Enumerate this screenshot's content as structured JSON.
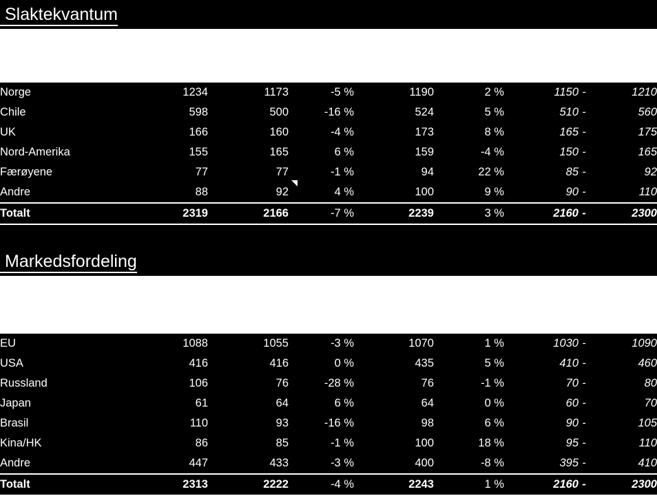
{
  "sections": [
    {
      "title": "Slaktekvantum",
      "rows": [
        {
          "label": "Norge",
          "v1": "1234",
          "v2": "1173",
          "p1": "-5 %",
          "v3": "1190",
          "p2": "2 %",
          "rlo": "1150",
          "dash": "-",
          "rhi": "1210"
        },
        {
          "label": "Chile",
          "v1": "598",
          "v2": "500",
          "p1": "-16 %",
          "v3": "524",
          "p2": "5 %",
          "rlo": "510",
          "dash": "-",
          "rhi": "560"
        },
        {
          "label": "UK",
          "v1": "166",
          "v2": "160",
          "p1": "-4 %",
          "v3": "173",
          "p2": "8 %",
          "rlo": "165",
          "dash": "-",
          "rhi": "175"
        },
        {
          "label": "Nord-Amerika",
          "v1": "155",
          "v2": "165",
          "p1": "6 %",
          "v3": "159",
          "p2": "-4 %",
          "rlo": "150",
          "dash": "-",
          "rhi": "165"
        },
        {
          "label": "Færøyene",
          "v1": "77",
          "v2": "77",
          "p1": "-1 %",
          "v3": "94",
          "p2": "22 %",
          "rlo": "85",
          "dash": "-",
          "rhi": "92"
        },
        {
          "label": "Andre",
          "v1": "88",
          "v2": "92",
          "p1": "4 %",
          "v3": "100",
          "p2": "9 %",
          "rlo": "90",
          "dash": "-",
          "rhi": "110"
        }
      ],
      "total": {
        "label": "Totalt",
        "v1": "2319",
        "v2": "2166",
        "p1": "-7 %",
        "v3": "2239",
        "p2": "3 %",
        "rlo": "2160",
        "dash": "-",
        "rhi": "2300"
      }
    },
    {
      "title": "Markedsfordeling",
      "rows": [
        {
          "label": "EU",
          "v1": "1088",
          "v2": "1055",
          "p1": "-3 %",
          "v3": "1070",
          "p2": "1 %",
          "rlo": "1030",
          "dash": "-",
          "rhi": "1090"
        },
        {
          "label": "USA",
          "v1": "416",
          "v2": "416",
          "p1": "0 %",
          "v3": "435",
          "p2": "5 %",
          "rlo": "410",
          "dash": "-",
          "rhi": "460"
        },
        {
          "label": "Russland",
          "v1": "106",
          "v2": "76",
          "p1": "-28 %",
          "v3": "76",
          "p2": "-1 %",
          "rlo": "70",
          "dash": "-",
          "rhi": "80"
        },
        {
          "label": "Japan",
          "v1": "61",
          "v2": "64",
          "p1": "6 %",
          "v3": "64",
          "p2": "0 %",
          "rlo": "60",
          "dash": "-",
          "rhi": "70"
        },
        {
          "label": "Brasil",
          "v1": "110",
          "v2": "93",
          "p1": "-16 %",
          "v3": "98",
          "p2": "6 %",
          "rlo": "90",
          "dash": "-",
          "rhi": "105"
        },
        {
          "label": "Kina/HK",
          "v1": "86",
          "v2": "85",
          "p1": "-1 %",
          "v3": "100",
          "p2": "18 %",
          "rlo": "95",
          "dash": "-",
          "rhi": "110"
        },
        {
          "label": "Andre",
          "v1": "447",
          "v2": "433",
          "p1": "-3 %",
          "v3": "400",
          "p2": "-8 %",
          "rlo": "395",
          "dash": "-",
          "rhi": "410"
        }
      ],
      "total": {
        "label": "Totalt",
        "v1": "2313",
        "v2": "2222",
        "p1": "-4 %",
        "v3": "2243",
        "p2": "1 %",
        "rlo": "2160",
        "dash": "-",
        "rhi": "2300"
      }
    }
  ],
  "colors": {
    "background": "#000000",
    "text": "#ffffff",
    "rule": "#ffffff",
    "header_band": "#ffffff"
  }
}
